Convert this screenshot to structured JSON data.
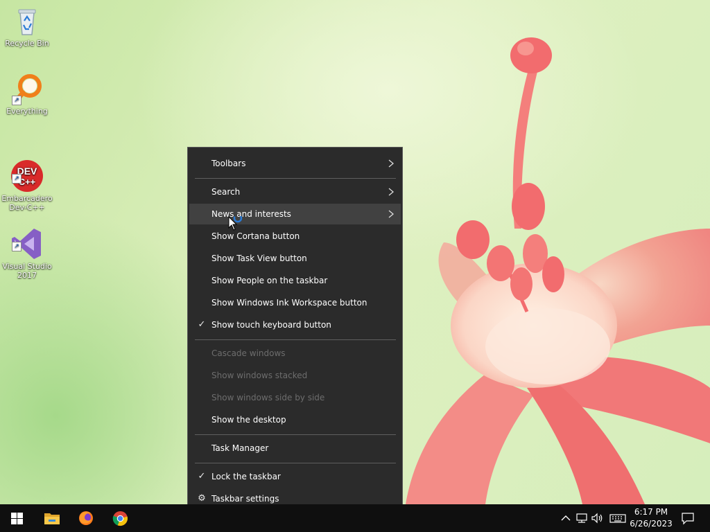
{
  "desktop": {
    "icons": [
      {
        "label": "Recycle Bin",
        "icon": "recycle-bin-icon"
      },
      {
        "label": "Everything",
        "icon": "magnifier-icon"
      },
      {
        "label": "Embarcadero\nDev-C++",
        "icon": "devcpp-icon"
      },
      {
        "label": "Visual Studio\n2017",
        "icon": "visual-studio-icon"
      }
    ]
  },
  "context_menu": {
    "items": [
      {
        "label": "Toolbars",
        "submenu": true
      },
      {
        "label": "Search",
        "submenu": true
      },
      {
        "label": "News and interests",
        "submenu": true,
        "highlighted": true
      },
      {
        "label": "Show Cortana button"
      },
      {
        "label": "Show Task View button"
      },
      {
        "label": "Show People on the taskbar"
      },
      {
        "label": "Show Windows Ink Workspace button"
      },
      {
        "label": "Show touch keyboard button",
        "checked": true
      },
      {
        "label": "Cascade windows",
        "disabled": true
      },
      {
        "label": "Show windows stacked",
        "disabled": true
      },
      {
        "label": "Show windows side by side",
        "disabled": true
      },
      {
        "label": "Show the desktop"
      },
      {
        "label": "Task Manager"
      },
      {
        "label": "Lock the taskbar",
        "checked": true
      },
      {
        "label": "Taskbar settings",
        "icon": "gear-icon"
      }
    ]
  },
  "taskbar": {
    "pinned": [
      "windows-start-icon",
      "file-explorer-icon",
      "firefox-icon",
      "chrome-icon"
    ],
    "tray": [
      "chevron-up-icon",
      "network-icon",
      "volume-icon",
      "keyboard-icon"
    ],
    "time": "6:17 PM",
    "date": "6/26/2023"
  },
  "colors": {
    "menu_bg": "#2b2b2b",
    "menu_hover": "#414141",
    "menu_disabled_text": "#6d6d6d",
    "taskbar_bg": "#0f0f0f",
    "flower": "#f27a7a"
  }
}
